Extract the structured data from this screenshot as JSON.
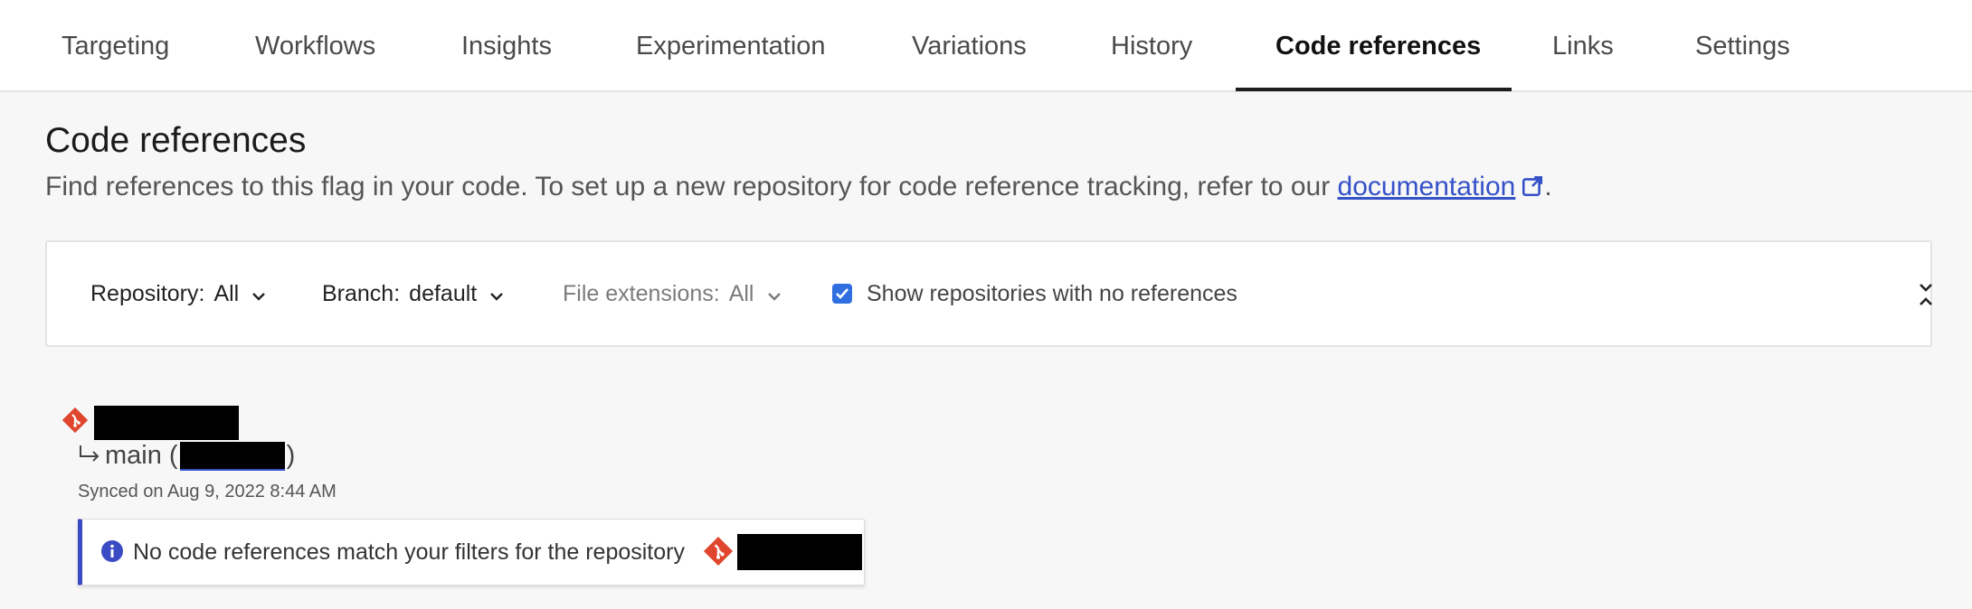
{
  "tabs": [
    {
      "label": "Targeting"
    },
    {
      "label": "Workflows"
    },
    {
      "label": "Insights"
    },
    {
      "label": "Experimentation"
    },
    {
      "label": "Variations"
    },
    {
      "label": "History"
    },
    {
      "label": "Code references",
      "active": true
    },
    {
      "label": "Links"
    },
    {
      "label": "Settings"
    }
  ],
  "page": {
    "title": "Code references",
    "subtitle_prefix": "Find references to this flag in your code. To set up a new repository for code reference tracking, refer to our ",
    "doc_link": "documentation",
    "subtitle_suffix": "."
  },
  "filters": {
    "repository": {
      "label": "Repository:",
      "value": "All"
    },
    "branch": {
      "label": "Branch:",
      "value": "default"
    },
    "file_extensions": {
      "label": "File extensions:",
      "value": "All"
    },
    "show_empty": {
      "label": "Show repositories with no references",
      "checked": true
    }
  },
  "repository": {
    "branch": "main (",
    "branch_close": ")",
    "synced": "Synced on Aug 9, 2022 8:44 AM",
    "notice": "No code references match your filters for the repository"
  },
  "colors": {
    "accent": "#3b4bc3",
    "link": "#3552c8",
    "git": "#e0452d",
    "checkbox": "#2f6fe0"
  },
  "icons": [
    "external-link-icon",
    "chevron-down-icon",
    "collapse-icon",
    "git-icon",
    "info-icon"
  ]
}
